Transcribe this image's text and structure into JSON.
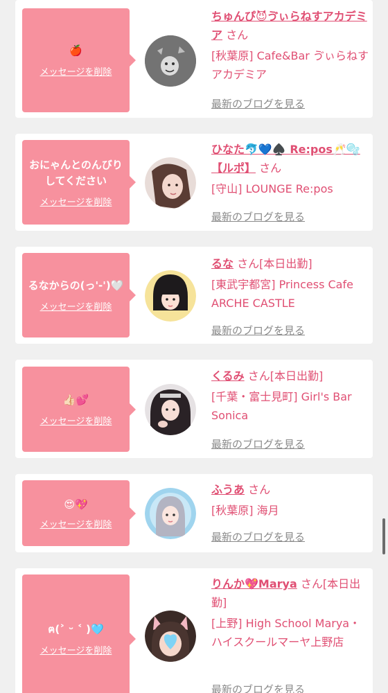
{
  "delete_label": "メッセージを削除",
  "blog_label": "最新のブログを見る",
  "honorific": "さん",
  "cards": [
    {
      "message": "🍎",
      "name": "ちゅんぴ😈ゔぃらねすアカデミア",
      "suffix": "さん",
      "shop": "[秋葉原] Cafe&Bar ゔぃらねすアカデミア"
    },
    {
      "message": "おにゃんとのんびりしてください",
      "name": "ひなた🐬💙♠️ Re:pos🥂🫧【ルポ】",
      "suffix": "さん",
      "shop": "[守山] LOUNGE Re:pos"
    },
    {
      "message": "るなからの(っ'-')🤍",
      "name": "るな",
      "suffix": "さん[本日出勤]",
      "shop": "[東武宇都宮] Princess Cafe ARCHE CASTLE"
    },
    {
      "message": "👍🏻💕",
      "name": "くるみ",
      "suffix": "さん[本日出勤]",
      "shop": "[千葉・富士見町] Girl's Bar Sonica"
    },
    {
      "message": "😍💖",
      "name": "ふうあ",
      "suffix": "さん",
      "shop": "[秋葉原] 海月"
    },
    {
      "message": "ฅ(˃ ᵕ ˂ )🩵",
      "name": "りんか💖Marya",
      "suffix": "さん[本日出勤]",
      "shop": "[上野] High School Marya・ハイスクールマーヤ上野店"
    }
  ],
  "colors": {
    "accent": "#e04f73",
    "message_bg": "#f7919e",
    "page_bg": "#f0f0f0"
  }
}
